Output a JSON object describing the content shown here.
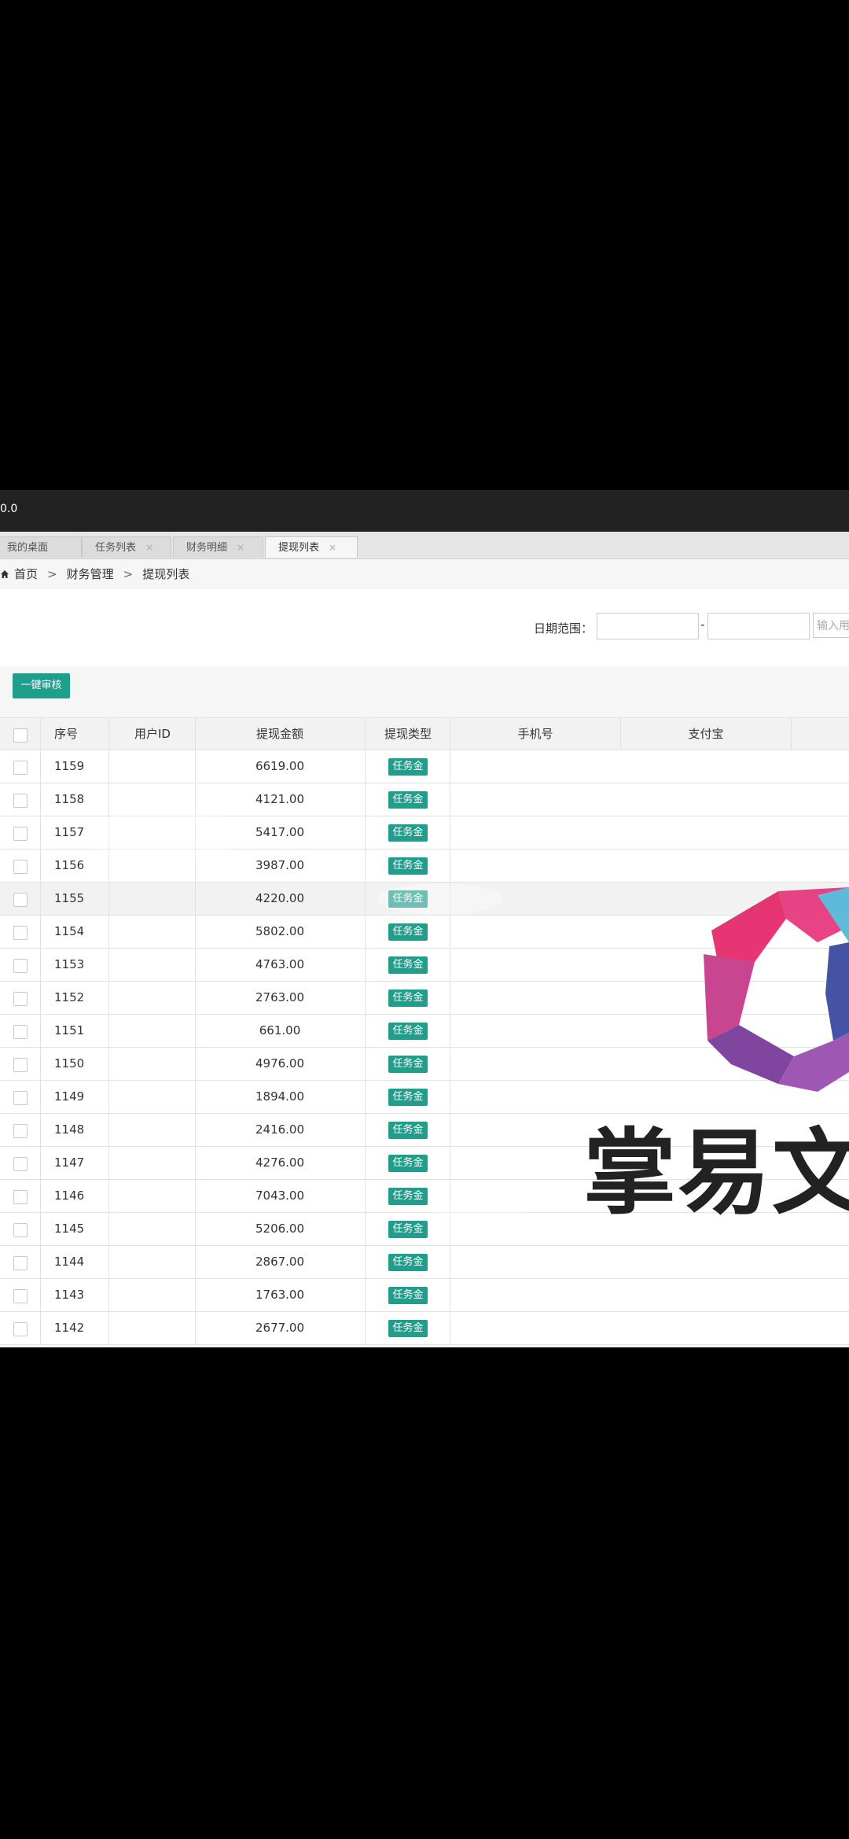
{
  "window": {
    "title_fragment": "0.0"
  },
  "tabs": [
    {
      "label": "我的桌面",
      "active": false,
      "closable": false
    },
    {
      "label": "任务列表",
      "active": false,
      "closable": true
    },
    {
      "label": "财务明细",
      "active": false,
      "closable": true
    },
    {
      "label": "提现列表",
      "active": true,
      "closable": true
    }
  ],
  "tab_close_glyph": "×",
  "breadcrumb": {
    "home": "首页",
    "section": "财务管理",
    "page": "提现列表",
    "separator": ">"
  },
  "filter": {
    "date_label": "日期范围：",
    "date_sep": "-",
    "user_input_placeholder": "输入用"
  },
  "toolbar": {
    "batch_review_label": "一键审核"
  },
  "table": {
    "columns": {
      "seq": "序号",
      "user_id": "用户ID",
      "amount": "提现金额",
      "type": "提现类型",
      "phone": "手机号",
      "alipay": "支付宝"
    },
    "rows": [
      {
        "seq": "1159",
        "amount": "6619.00",
        "type": "任务金"
      },
      {
        "seq": "1158",
        "amount": "4121.00",
        "type": "任务金"
      },
      {
        "seq": "1157",
        "amount": "5417.00",
        "type": "任务金"
      },
      {
        "seq": "1156",
        "amount": "3987.00",
        "type": "任务金"
      },
      {
        "seq": "1155",
        "amount": "4220.00",
        "type": "任务金"
      },
      {
        "seq": "1154",
        "amount": "5802.00",
        "type": "任务金"
      },
      {
        "seq": "1153",
        "amount": "4763.00",
        "type": "任务金"
      },
      {
        "seq": "1152",
        "amount": "2763.00",
        "type": "任务金"
      },
      {
        "seq": "1151",
        "amount": "661.00",
        "type": "任务金"
      },
      {
        "seq": "1150",
        "amount": "4976.00",
        "type": "任务金"
      },
      {
        "seq": "1149",
        "amount": "1894.00",
        "type": "任务金"
      },
      {
        "seq": "1148",
        "amount": "2416.00",
        "type": "任务金"
      },
      {
        "seq": "1147",
        "amount": "4276.00",
        "type": "任务金"
      },
      {
        "seq": "1146",
        "amount": "7043.00",
        "type": "任务金"
      },
      {
        "seq": "1145",
        "amount": "5206.00",
        "type": "任务金"
      },
      {
        "seq": "1144",
        "amount": "2867.00",
        "type": "任务金"
      },
      {
        "seq": "1143",
        "amount": "1763.00",
        "type": "任务金"
      },
      {
        "seq": "1142",
        "amount": "2677.00",
        "type": "任务金"
      }
    ],
    "highlighted_seq": "1155"
  },
  "watermark": {
    "text": "掌易文"
  },
  "colors": {
    "accent": "#1e9e8b",
    "titlebar": "#222222",
    "letterbox": "#000000"
  }
}
